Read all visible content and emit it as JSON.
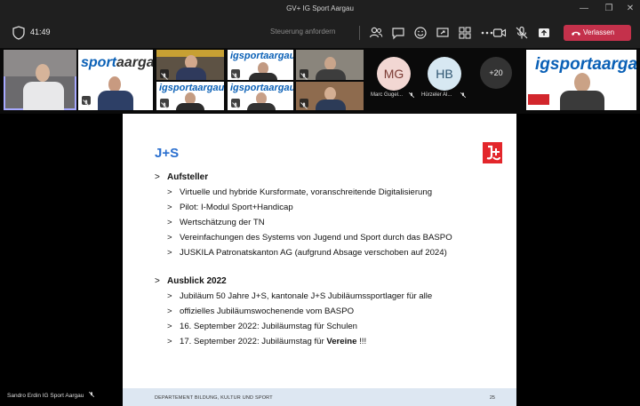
{
  "window": {
    "title": "GV+ IG Sport Aargau"
  },
  "toolbar": {
    "timer": "41:49",
    "control_label": "Steuerung anfordern",
    "leave_label": "Verlassen"
  },
  "participants": {
    "avatars": [
      {
        "initials": "MG",
        "name": "Marc Gugel...",
        "bg": "#f2d7d3",
        "fg": "#7a3a33"
      },
      {
        "initials": "HB",
        "name": "Hürzeler Al...",
        "bg": "#d7e8f2",
        "fg": "#2f5570"
      }
    ],
    "more_count": "+20",
    "logo_text_ig": "ig",
    "logo_text_main": "sportaargau",
    "logo_text_sport": "sport",
    "logo_text_aargau": "aargau"
  },
  "slide": {
    "title": "J+S",
    "marker": ">",
    "sections": [
      {
        "heading": "Aufsteller",
        "items": [
          "Virtuelle und hybride Kursformate, voranschreitende Digitalisierung",
          "Pilot: I-Modul Sport+Handicap",
          "Wertschätzung der TN",
          "Vereinfachungen des Systems von Jugend und Sport durch das BASPO",
          "JUSKILA Patronatskanton AG (aufgrund Absage verschoben auf 2024)"
        ]
      },
      {
        "heading": "Ausblick 2022",
        "items": [
          "Jubiläum 50 Jahre J+S, kantonale J+S Jubiläumssportlager für alle",
          "offizielles Jubiläumswochenende vom BASPO",
          "16. September 2022: Jubiläumstag für Schulen"
        ],
        "last_item_prefix": "17. September 2022: Jubiläumstag für ",
        "last_item_bold": "Vereine",
        "last_item_suffix": " !!!"
      }
    ],
    "footer_dept": "DEPARTEMENT BILDUNG, KULTUR UND SPORT",
    "page_number": "25"
  },
  "presenter": {
    "name": "Sandro Erdin IG Sport Aargau"
  },
  "colors": {
    "accent": "#2a6fcf",
    "leave": "#c4314b",
    "logo_blue": "#0a60b6",
    "js_red": "#e3262b"
  }
}
